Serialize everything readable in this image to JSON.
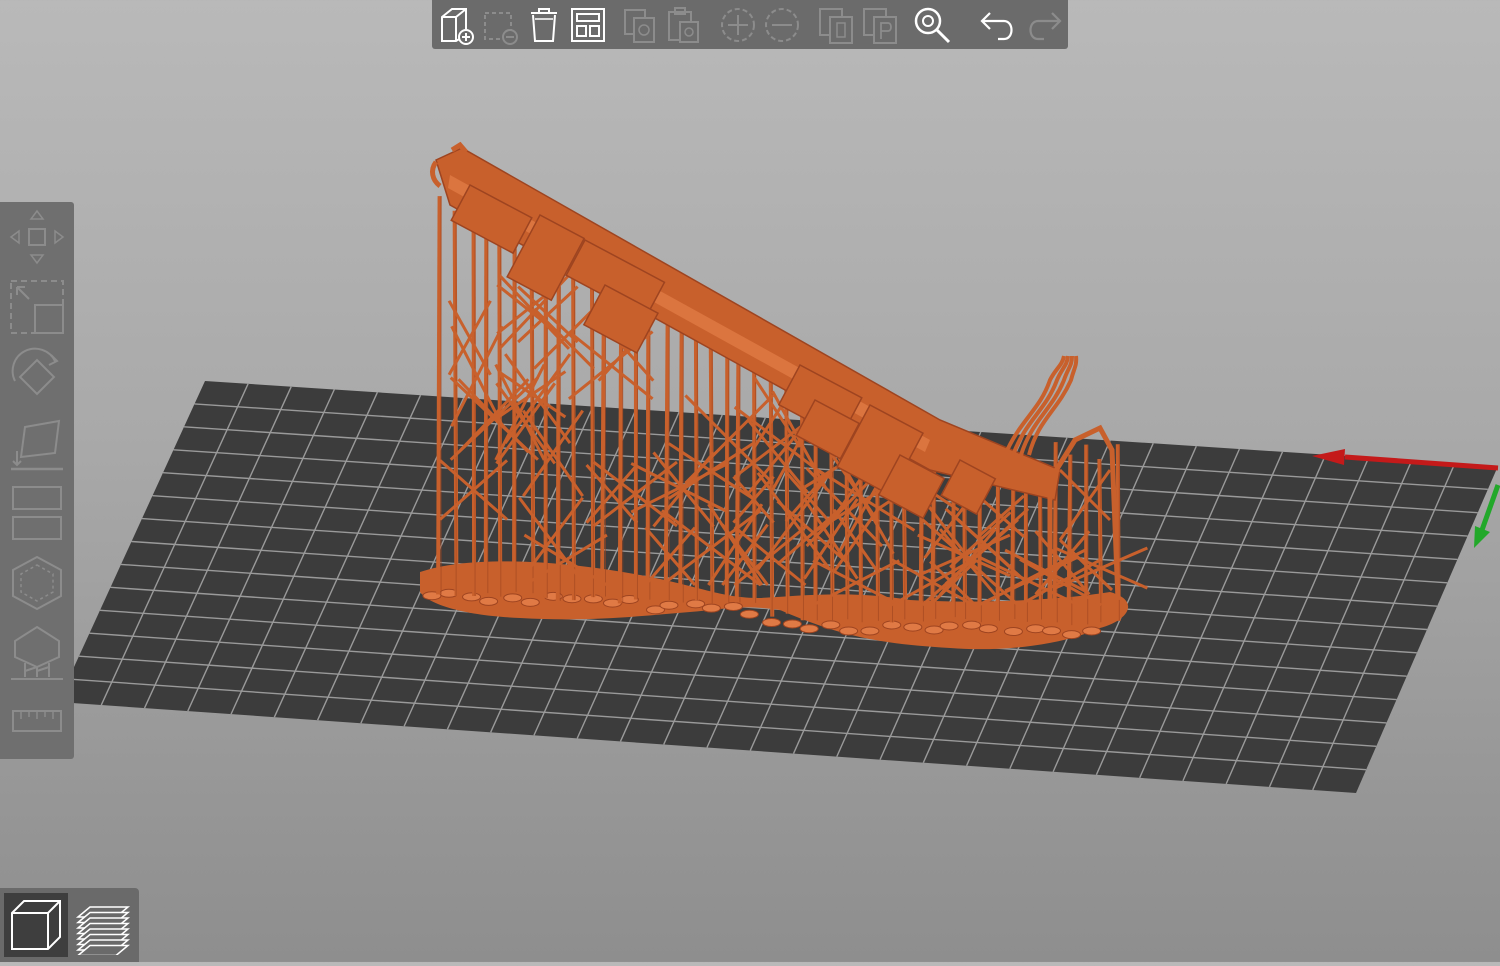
{
  "colors": {
    "model": "#c8602c",
    "plate": "#3c3c3c",
    "grid_lines": "#9a9a9a",
    "axis_x": "#c41a1a",
    "axis_y": "#22a82a",
    "toolbar_bg": "#6b6b6b",
    "icon_enabled": "#ffffff",
    "icon_disabled": "#8c8c8c"
  },
  "top_toolbar": {
    "buttons": [
      {
        "icon": "add-object-icon",
        "enabled": true
      },
      {
        "icon": "delete-object-icon",
        "enabled": false
      },
      {
        "icon": "delete-all-icon",
        "enabled": true
      },
      {
        "icon": "arrange-icon",
        "enabled": true
      },
      {
        "icon": "copy-icon",
        "enabled": false
      },
      {
        "icon": "paste-icon",
        "enabled": false
      },
      {
        "icon": "add-instance-icon",
        "enabled": false
      },
      {
        "icon": "remove-instance-icon",
        "enabled": false
      },
      {
        "icon": "split-objects-icon",
        "enabled": false
      },
      {
        "icon": "split-parts-icon",
        "enabled": false
      },
      {
        "icon": "search-icon",
        "enabled": true
      },
      {
        "icon": "undo-icon",
        "enabled": true
      },
      {
        "icon": "redo-icon",
        "enabled": false
      }
    ]
  },
  "left_toolbar": {
    "tools": [
      {
        "icon": "move-icon",
        "enabled": false
      },
      {
        "icon": "scale-icon",
        "enabled": false
      },
      {
        "icon": "rotate-icon",
        "enabled": false
      },
      {
        "icon": "place-on-face-icon",
        "enabled": false
      },
      {
        "icon": "cut-icon",
        "enabled": false
      },
      {
        "icon": "hollow-icon",
        "enabled": false
      },
      {
        "icon": "sla-supports-icon",
        "enabled": false
      },
      {
        "icon": "measure-icon",
        "enabled": false
      }
    ]
  },
  "view_switch": {
    "active": "3d-view",
    "buttons": [
      {
        "icon": "3d-view-icon",
        "active": true
      },
      {
        "icon": "preview-layers-icon",
        "active": false
      }
    ]
  }
}
